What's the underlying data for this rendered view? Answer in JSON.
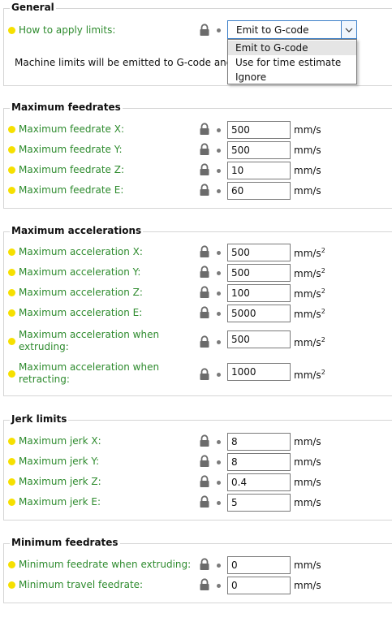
{
  "general": {
    "title": "General",
    "apply_label": "How to apply limits:",
    "select_value": "Emit to G-code",
    "options": [
      "Emit to G-code",
      "Use for time estimate",
      "Ignore"
    ],
    "note": "Machine limits will be emitted to G-code and use"
  },
  "feedrates": {
    "title": "Maximum feedrates",
    "rows": [
      {
        "label": "Maximum feedrate X:",
        "value": "500",
        "unit": "mm/s"
      },
      {
        "label": "Maximum feedrate Y:",
        "value": "500",
        "unit": "mm/s"
      },
      {
        "label": "Maximum feedrate Z:",
        "value": "10",
        "unit": "mm/s"
      },
      {
        "label": "Maximum feedrate E:",
        "value": "60",
        "unit": "mm/s"
      }
    ]
  },
  "accelerations": {
    "title": "Maximum accelerations",
    "unit": "mm/s",
    "unit_sup": "2",
    "rows": [
      {
        "label": "Maximum acceleration X:",
        "value": "500"
      },
      {
        "label": "Maximum acceleration Y:",
        "value": "500"
      },
      {
        "label": "Maximum acceleration Z:",
        "value": "100"
      },
      {
        "label": "Maximum acceleration E:",
        "value": "5000"
      },
      {
        "label1": "Maximum acceleration when",
        "label2": "extruding:",
        "value": "500"
      },
      {
        "label1": "Maximum acceleration when",
        "label2": "retracting:",
        "value": "1000"
      }
    ]
  },
  "jerk": {
    "title": "Jerk limits",
    "rows": [
      {
        "label": "Maximum jerk X:",
        "value": "8",
        "unit": "mm/s"
      },
      {
        "label": "Maximum jerk Y:",
        "value": "8",
        "unit": "mm/s"
      },
      {
        "label": "Maximum jerk Z:",
        "value": "0.4",
        "unit": "mm/s"
      },
      {
        "label": "Maximum jerk E:",
        "value": "5",
        "unit": "mm/s"
      }
    ]
  },
  "minimum": {
    "title": "Minimum feedrates",
    "rows": [
      {
        "label": "Minimum feedrate when extruding:",
        "value": "0",
        "unit": "mm/s"
      },
      {
        "label": "Minimum travel feedrate:",
        "value": "0",
        "unit": "mm/s"
      }
    ]
  },
  "colors": {
    "label_green": "#2e8b2e",
    "dot_yellow": "#f6e000",
    "select_border": "#3c7fc8"
  },
  "icons": {
    "lock": "lock-icon",
    "bullet": "bullet-icon",
    "chevron": "chevron-down-icon"
  }
}
